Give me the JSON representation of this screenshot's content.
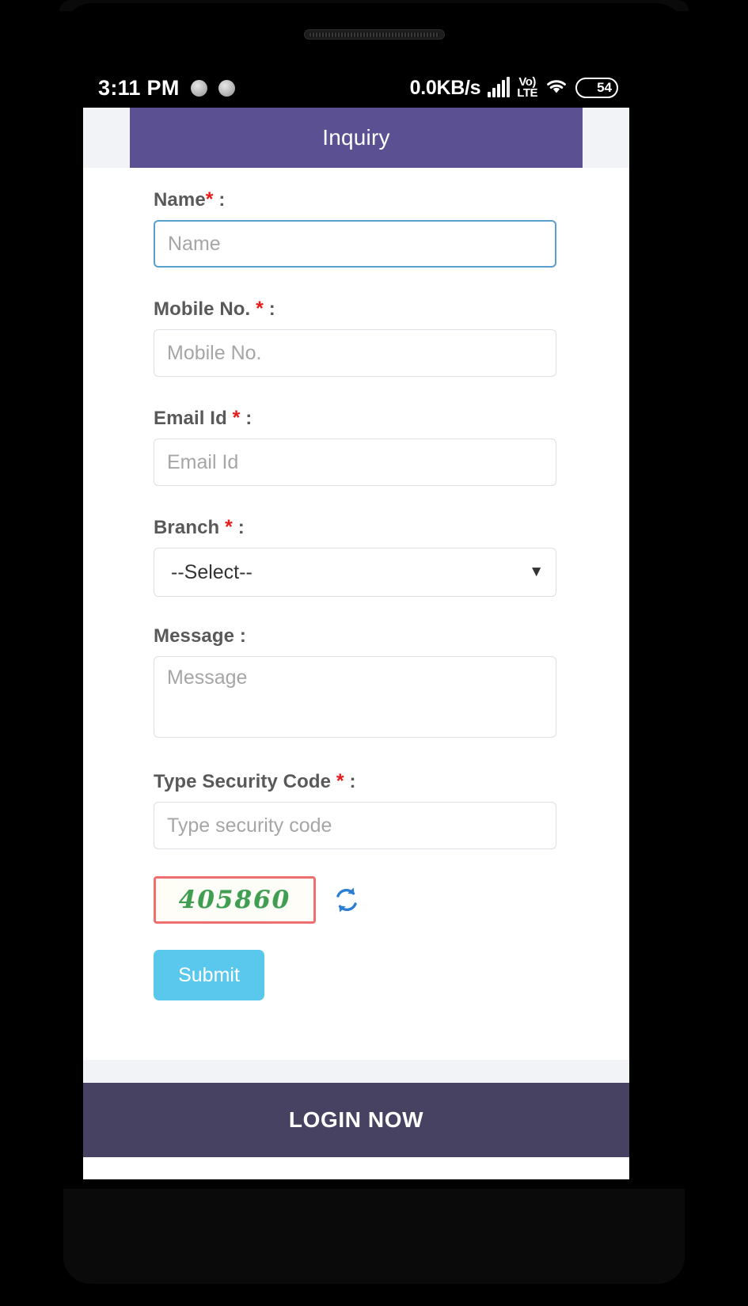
{
  "status_bar": {
    "time": "3:11 PM",
    "network_speed": "0.0KB/s",
    "volte_top": "Vo)",
    "volte_bottom": "LTE",
    "battery_level": "54",
    "battery_percent": 54,
    "signal_icon": "signal-bars-icon",
    "wifi_icon": "wifi-icon"
  },
  "header": {
    "title": "Inquiry",
    "background_color": "#5b5192"
  },
  "form": {
    "fields": [
      {
        "label": "Name",
        "required": true,
        "placeholder": "Name",
        "value": "",
        "type": "text",
        "focused": true
      },
      {
        "label": "Mobile No.",
        "required": true,
        "placeholder": "Mobile No.",
        "value": "",
        "type": "text",
        "focused": false
      },
      {
        "label": "Email Id",
        "required": true,
        "placeholder": "Email Id",
        "value": "",
        "type": "text",
        "focused": false
      },
      {
        "label": "Branch",
        "required": true,
        "placeholder": "--Select--",
        "value": "--Select--",
        "type": "select",
        "focused": false
      },
      {
        "label": "Message",
        "required": false,
        "placeholder": "Message",
        "value": "",
        "type": "textarea",
        "focused": false
      },
      {
        "label": "Type Security Code",
        "required": true,
        "placeholder": "Type security code",
        "value": "",
        "type": "text",
        "focused": false
      }
    ],
    "required_marker": "*",
    "label_colon": ":",
    "branch_options": [
      "--Select--"
    ],
    "captcha": {
      "code": "405860",
      "border_color": "#ef6e6e",
      "text_color": "#3f9e52",
      "refresh_icon": "refresh-icon"
    },
    "submit_label": "Submit",
    "submit_color": "#5ac8ec"
  },
  "footer": {
    "login_label": "LOGIN NOW",
    "background_color": "#474261"
  },
  "nav_bar": {
    "recents_icon": "square-recents-icon",
    "home_icon": "circle-home-icon",
    "back_icon": "triangle-back-icon"
  }
}
